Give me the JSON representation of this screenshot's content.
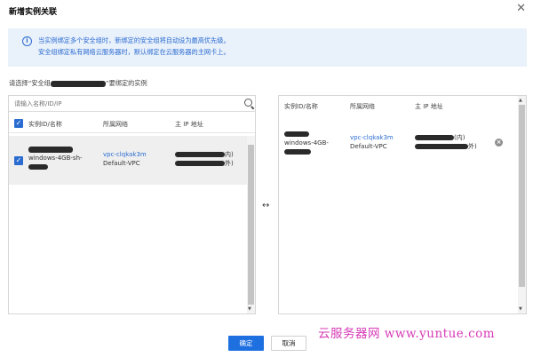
{
  "dialog": {
    "title": "新增实例关联",
    "close_icon": "close-icon"
  },
  "notice": {
    "icon": "info-icon",
    "line1": "当实例绑定多个安全组时，新绑定的安全组将自动设为最高优先级。",
    "line2": "安全组绑定私有网络云服务器时，默认绑定在云服务器的主网卡上。"
  },
  "select_label": {
    "prefix": "请选择“安全组",
    "suffix": "”要绑定的实例"
  },
  "search": {
    "placeholder": "请输入名称/ID/IP",
    "icon": "search-icon"
  },
  "left_table": {
    "headers": {
      "instance": "实例ID/名称",
      "network": "所属网络",
      "ip": "主 IP 地址"
    },
    "rows": [
      {
        "checked": true,
        "instance_name": "windows-4GB-sh-",
        "vpc_id": "vpc-clqkak3m",
        "vpc_name": "Default-VPC",
        "ip_private_suffix": "内)",
        "ip_public_suffix": "外)"
      }
    ]
  },
  "swap_icon": "↔",
  "right_table": {
    "headers": {
      "instance": "实例ID/名称",
      "network": "所属网络",
      "ip": "主 IP 地址"
    },
    "rows": [
      {
        "instance_name": "windows-4GB-",
        "vpc_id": "vpc-clqkak3m",
        "vpc_name": "Default-VPC",
        "ip_private_suffix": "(内)",
        "ip_public_suffix": "外)",
        "remove_icon": "remove-icon"
      }
    ]
  },
  "buttons": {
    "confirm": "确定",
    "cancel": "取消"
  },
  "watermark": "云服务器网 www.yuntue.com",
  "colors": {
    "accent": "#1e6fe0",
    "notice_bg": "#e9f1fb",
    "link": "#2b6cd1",
    "watermark": "#d63ab6"
  }
}
